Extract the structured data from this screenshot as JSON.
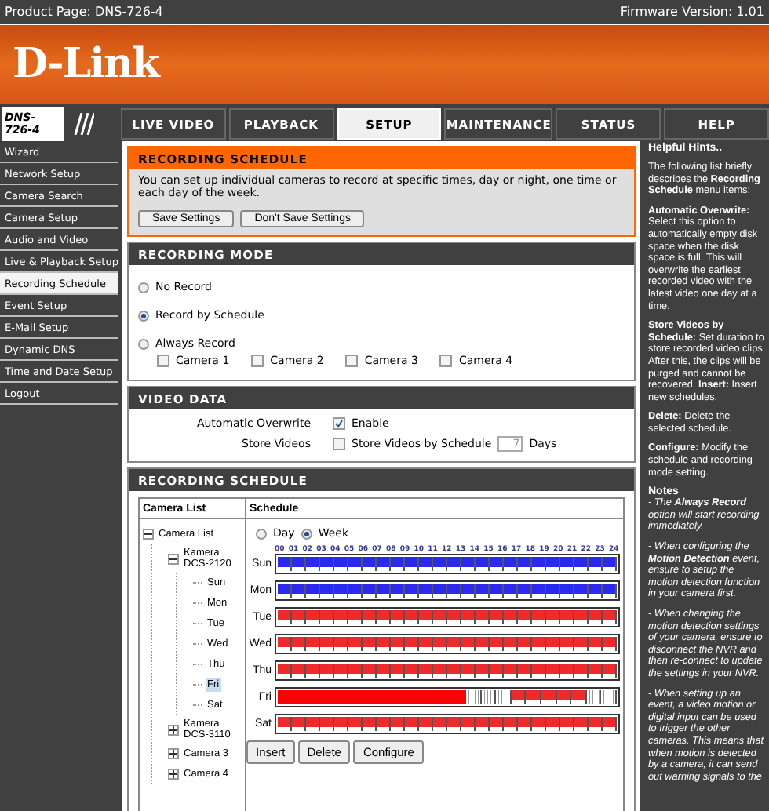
{
  "header": {
    "product": "Product Page: DNS-726-4",
    "firmware": "Firmware Version: 1.01"
  },
  "logo": "D-Link",
  "model_badge": "DNS-726-4",
  "tabs": [
    {
      "label": "LIVE VIDEO",
      "selected": false
    },
    {
      "label": "PLAYBACK",
      "selected": false
    },
    {
      "label": "SETUP",
      "selected": true
    },
    {
      "label": "MAINTENANCE",
      "selected": false
    },
    {
      "label": "STATUS",
      "selected": false
    },
    {
      "label": "HELP",
      "selected": false
    }
  ],
  "sidebar": {
    "items": [
      {
        "label": "Wizard",
        "selected": false
      },
      {
        "label": "Network Setup",
        "selected": false
      },
      {
        "label": "Camera Search",
        "selected": false
      },
      {
        "label": "Camera Setup",
        "selected": false
      },
      {
        "label": "Audio and Video",
        "selected": false
      },
      {
        "label": "Live & Playback Setup",
        "selected": false
      },
      {
        "label": "Recording Schedule",
        "selected": true
      },
      {
        "label": "Event Setup",
        "selected": false
      },
      {
        "label": "E-Mail Setup",
        "selected": false
      },
      {
        "label": "Dynamic DNS",
        "selected": false
      },
      {
        "label": "Time and Date Setup",
        "selected": false
      },
      {
        "label": "Logout",
        "selected": false
      }
    ]
  },
  "intro": {
    "title": "RECORDING SCHEDULE",
    "text": "You can set up individual cameras to record at specific times, day or night, one time or each day of the week.",
    "buttons": [
      "Save Settings",
      "Don't Save Settings"
    ]
  },
  "recording_mode": {
    "title": "RECORDING MODE",
    "options": [
      {
        "label": "No Record",
        "selected": false
      },
      {
        "label": "Record by Schedule",
        "selected": true
      },
      {
        "label": "Always Record",
        "selected": false
      }
    ],
    "cameras": [
      {
        "label": "Camera 1",
        "checked": false
      },
      {
        "label": "Camera 2",
        "checked": false
      },
      {
        "label": "Camera 3",
        "checked": false
      },
      {
        "label": "Camera 4",
        "checked": false
      }
    ]
  },
  "video_data": {
    "title": "VIDEO DATA",
    "overwrite": {
      "label": "Automatic Overwrite",
      "option": "Enable",
      "checked": true
    },
    "store": {
      "label": "Store Videos",
      "option": "Store Videos by Schedule",
      "checked": false,
      "value": "7",
      "unit": "Days"
    }
  },
  "schedule": {
    "title": "RECORDING SCHEDULE",
    "camera_list_heading": "Camera List",
    "schedule_heading": "Schedule",
    "tree": [
      {
        "label": "Camera List",
        "expanded": true,
        "children": [
          {
            "label": "Kamera DCS-2120",
            "expanded": true,
            "children": [
              {
                "label": "Sun",
                "selected": false
              },
              {
                "label": "Mon",
                "selected": false
              },
              {
                "label": "Tue",
                "selected": false
              },
              {
                "label": "Wed",
                "selected": false
              },
              {
                "label": "Thu",
                "selected": false
              },
              {
                "label": "Fri",
                "selected": true
              },
              {
                "label": "Sat",
                "selected": false
              }
            ]
          },
          {
            "label": "Kamera DCS-3110",
            "expanded": false
          },
          {
            "label": "Camera 3",
            "expanded": false
          },
          {
            "label": "Camera 4",
            "expanded": false
          }
        ]
      }
    ],
    "view": [
      {
        "label": "Day",
        "selected": false
      },
      {
        "label": "Week",
        "selected": true
      }
    ],
    "hours": [
      "00",
      "01",
      "02",
      "03",
      "04",
      "05",
      "06",
      "07",
      "08",
      "09",
      "10",
      "11",
      "12",
      "13",
      "14",
      "15",
      "16",
      "17",
      "18",
      "19",
      "20",
      "21",
      "22",
      "23",
      "24"
    ],
    "days": [
      {
        "label": "Sun",
        "slots": [
          {
            "kind": "continuous"
          },
          {
            "kind": "continuous"
          },
          {
            "kind": "continuous"
          },
          {
            "kind": "continuous"
          },
          {
            "kind": "continuous"
          },
          {
            "kind": "continuous"
          },
          {
            "kind": "continuous"
          },
          {
            "kind": "continuous"
          },
          {
            "kind": "continuous"
          },
          {
            "kind": "continuous"
          },
          {
            "kind": "continuous"
          },
          {
            "kind": "continuous"
          },
          {
            "kind": "continuous"
          },
          {
            "kind": "continuous"
          },
          {
            "kind": "continuous"
          },
          {
            "kind": "continuous"
          },
          {
            "kind": "continuous"
          },
          {
            "kind": "continuous"
          },
          {
            "kind": "continuous"
          },
          {
            "kind": "continuous"
          },
          {
            "kind": "continuous"
          },
          {
            "kind": "continuous"
          },
          {
            "kind": "continuous"
          },
          {
            "kind": "continuous"
          }
        ]
      },
      {
        "label": "Mon",
        "slots": [
          {
            "kind": "continuous"
          },
          {
            "kind": "continuous"
          },
          {
            "kind": "continuous"
          },
          {
            "kind": "continuous"
          },
          {
            "kind": "continuous"
          },
          {
            "kind": "continuous"
          },
          {
            "kind": "continuous"
          },
          {
            "kind": "continuous"
          },
          {
            "kind": "continuous"
          },
          {
            "kind": "continuous"
          },
          {
            "kind": "continuous"
          },
          {
            "kind": "continuous"
          },
          {
            "kind": "continuous"
          },
          {
            "kind": "continuous"
          },
          {
            "kind": "continuous"
          },
          {
            "kind": "continuous"
          },
          {
            "kind": "continuous"
          },
          {
            "kind": "continuous"
          },
          {
            "kind": "continuous"
          },
          {
            "kind": "continuous"
          },
          {
            "kind": "continuous"
          },
          {
            "kind": "continuous"
          },
          {
            "kind": "continuous"
          },
          {
            "kind": "continuous"
          }
        ]
      },
      {
        "label": "Tue",
        "slots": [
          {
            "kind": "event"
          },
          {
            "kind": "event"
          },
          {
            "kind": "event"
          },
          {
            "kind": "event"
          },
          {
            "kind": "event"
          },
          {
            "kind": "event"
          },
          {
            "kind": "event"
          },
          {
            "kind": "event"
          },
          {
            "kind": "event"
          },
          {
            "kind": "event"
          },
          {
            "kind": "event"
          },
          {
            "kind": "event"
          },
          {
            "kind": "event"
          },
          {
            "kind": "event"
          },
          {
            "kind": "event"
          },
          {
            "kind": "event"
          },
          {
            "kind": "event"
          },
          {
            "kind": "event"
          },
          {
            "kind": "event"
          },
          {
            "kind": "event"
          },
          {
            "kind": "event"
          },
          {
            "kind": "event"
          },
          {
            "kind": "event"
          },
          {
            "kind": "event"
          }
        ]
      },
      {
        "label": "Wed",
        "slots": [
          {
            "kind": "event"
          },
          {
            "kind": "event"
          },
          {
            "kind": "event"
          },
          {
            "kind": "event"
          },
          {
            "kind": "event"
          },
          {
            "kind": "event"
          },
          {
            "kind": "event"
          },
          {
            "kind": "event"
          },
          {
            "kind": "event"
          },
          {
            "kind": "event"
          },
          {
            "kind": "event"
          },
          {
            "kind": "event"
          },
          {
            "kind": "event"
          },
          {
            "kind": "event"
          },
          {
            "kind": "event"
          },
          {
            "kind": "event"
          },
          {
            "kind": "event"
          },
          {
            "kind": "event"
          },
          {
            "kind": "event"
          },
          {
            "kind": "event"
          },
          {
            "kind": "event"
          },
          {
            "kind": "event"
          },
          {
            "kind": "event"
          },
          {
            "kind": "event"
          }
        ]
      },
      {
        "label": "Thu",
        "slots": [
          {
            "kind": "event"
          },
          {
            "kind": "event"
          },
          {
            "kind": "event"
          },
          {
            "kind": "event"
          },
          {
            "kind": "event"
          },
          {
            "kind": "event"
          },
          {
            "kind": "event"
          },
          {
            "kind": "event"
          },
          {
            "kind": "event"
          },
          {
            "kind": "event"
          },
          {
            "kind": "event"
          },
          {
            "kind": "event"
          },
          {
            "kind": "event"
          },
          {
            "kind": "event"
          },
          {
            "kind": "event"
          },
          {
            "kind": "event"
          },
          {
            "kind": "event"
          },
          {
            "kind": "event"
          },
          {
            "kind": "event"
          },
          {
            "kind": "event"
          },
          {
            "kind": "event"
          },
          {
            "kind": "event"
          },
          {
            "kind": "event"
          },
          {
            "kind": "event"
          }
        ]
      },
      {
        "label": "Fri",
        "slots": [
          {
            "kind": "selected"
          },
          {
            "kind": "selected"
          },
          {
            "kind": "selected"
          },
          {
            "kind": "selected"
          },
          {
            "kind": "selected"
          },
          {
            "kind": "selected"
          },
          {
            "kind": "selected"
          },
          {
            "kind": "selected"
          },
          {
            "kind": "selected"
          },
          {
            "kind": "selected"
          },
          {
            "kind": "selected"
          },
          {
            "kind": "selected"
          },
          {
            "kind": "selected"
          },
          {
            "kind": "selected"
          },
          {
            "kind": "empty"
          },
          {
            "kind": "empty"
          },
          {
            "kind": "empty"
          },
          {
            "kind": "event"
          },
          {
            "kind": "event"
          },
          {
            "kind": "event"
          },
          {
            "kind": "event"
          },
          {
            "kind": "event"
          },
          {
            "kind": "empty"
          },
          {
            "kind": "empty"
          }
        ]
      },
      {
        "label": "Sat",
        "slots": [
          {
            "kind": "event"
          },
          {
            "kind": "event"
          },
          {
            "kind": "event"
          },
          {
            "kind": "event"
          },
          {
            "kind": "event"
          },
          {
            "kind": "event"
          },
          {
            "kind": "event"
          },
          {
            "kind": "event"
          },
          {
            "kind": "event"
          },
          {
            "kind": "event"
          },
          {
            "kind": "event"
          },
          {
            "kind": "event"
          },
          {
            "kind": "event"
          },
          {
            "kind": "event"
          },
          {
            "kind": "event"
          },
          {
            "kind": "event"
          },
          {
            "kind": "event"
          },
          {
            "kind": "event"
          },
          {
            "kind": "event"
          },
          {
            "kind": "event"
          },
          {
            "kind": "event"
          },
          {
            "kind": "event"
          },
          {
            "kind": "event"
          },
          {
            "kind": "event"
          }
        ]
      }
    ],
    "buttons": [
      "Insert",
      "Delete",
      "Configure"
    ]
  },
  "hints": {
    "title": "Helpful Hints..",
    "paragraphs": [
      "The following list briefly describes the **Recording Schedule** menu items:",
      "**Automatic Overwrite:** Select this option to automatically empty disk space when the disk space is full. This will overwrite the earliest recorded video with the latest video one day at a time.",
      "**Store Videos by Schedule:** Set duration to store recorded video clips. After this, the clips will be purged and cannot be recovered.  **Insert:** Insert new schedules.",
      "**Delete:** Delete the selected schedule.",
      "**Configure:** Modify the schedule and recording mode setting."
    ],
    "notes": {
      "heading": "Notes",
      "items": [
        "- The **Always Record** option will start recording immediately.",
        "- When configuring the **Motion Detection** event, ensure to setup the motion detection function in your camera first.",
        "- When changing the motion detection settings of your camera, ensure to disconnect the NVR and then re-connect to update the settings in your NVR.",
        "- When setting up an event, a video motion or digital input can be used to trigger the other cameras. This means that when motion is detected by a camera, it can send out warning signals to the"
      ]
    }
  }
}
